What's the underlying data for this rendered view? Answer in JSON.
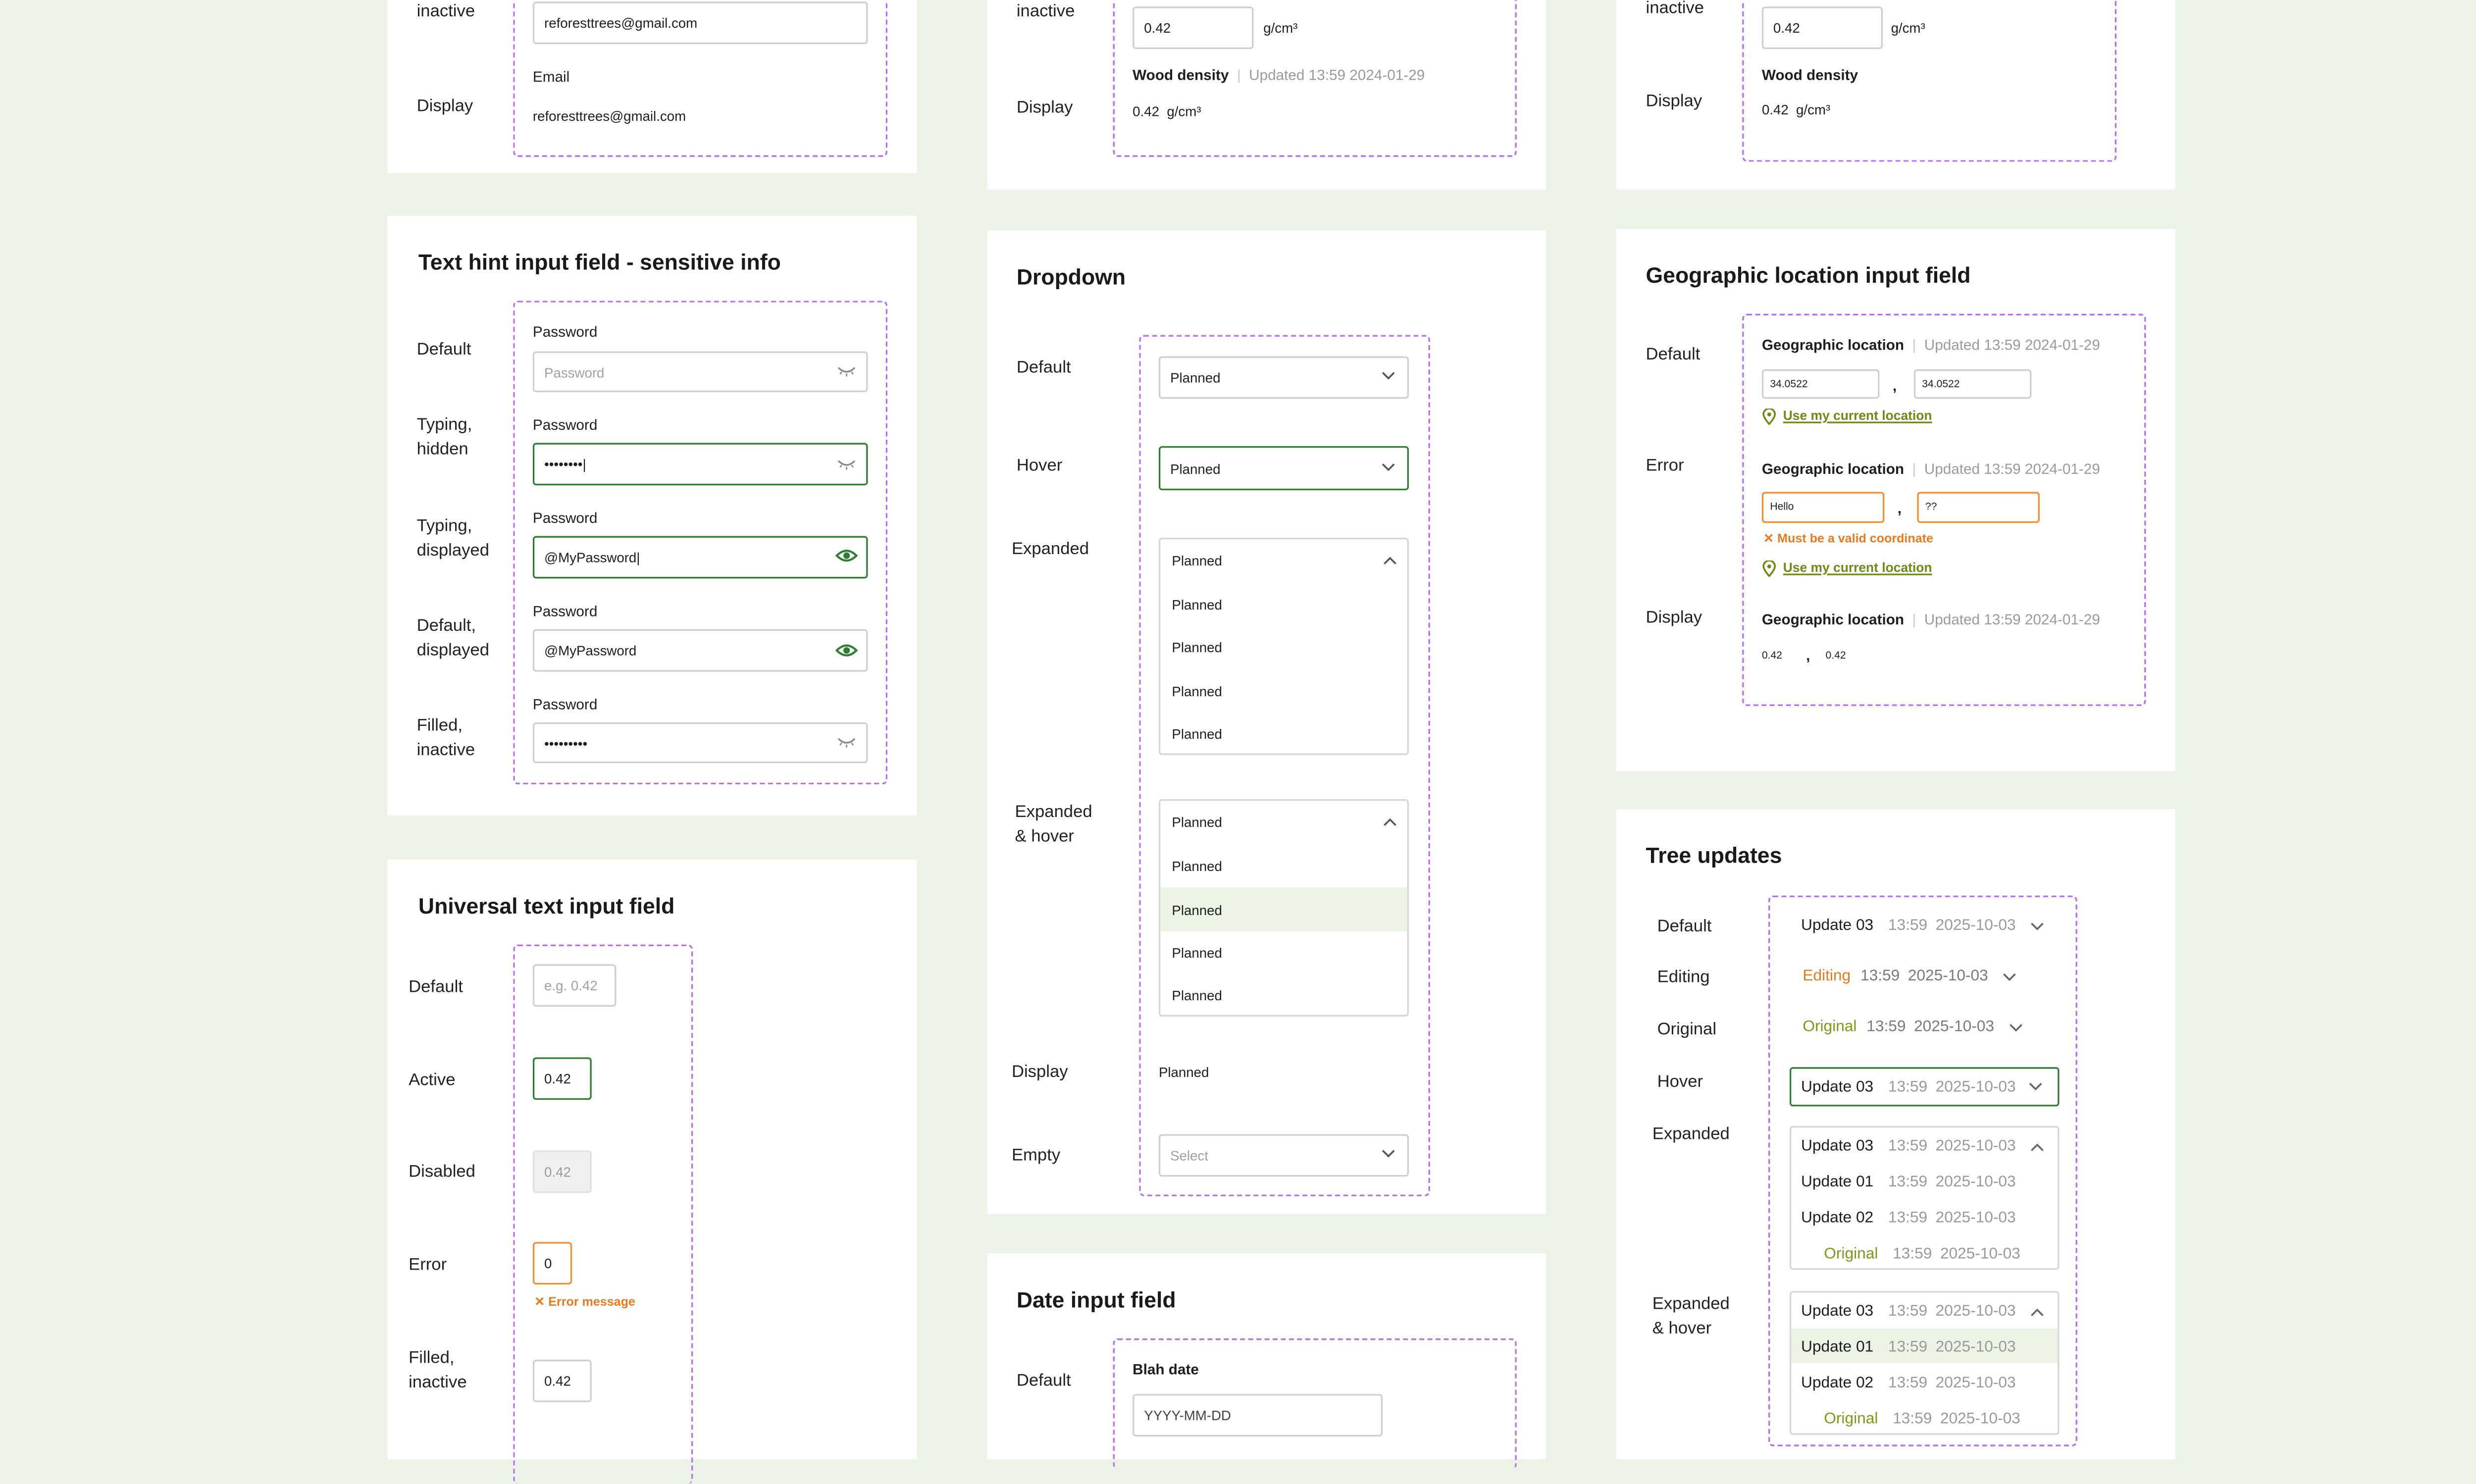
{
  "text_inputs": {
    "row_inactive": "inactive",
    "email_value": "reforesttrees@gmail.com",
    "row_display": "Display",
    "email_label": "Email",
    "email_display": "reforesttrees@gmail.com"
  },
  "density_a": {
    "row_inactive": "inactive",
    "value": "0.42",
    "unit": "g/cm³",
    "label": "Wood density",
    "updated": "Updated 13:59 2024-01-29",
    "row_display": "Display",
    "display_value": "0.42",
    "display_unit": "g/cm³"
  },
  "density_b": {
    "row_inactive": "inactive",
    "value": "0.42",
    "unit": "g/cm³",
    "label": "Wood density",
    "row_display": "Display",
    "display_value": "0.42",
    "display_unit": "g/cm³"
  },
  "password": {
    "title": "Text hint input field - sensitive info",
    "field_label": "Password",
    "placeholder": "Password",
    "states": [
      "Default",
      "Typing, hidden",
      "Typing, displayed",
      "Default, displayed",
      "Filled, inactive"
    ],
    "hidden_typing": "••••••••|",
    "typing_displayed": "@MyPassword|",
    "displayed": "@MyPassword",
    "hidden_filled": "•••••••••",
    "icons": [
      "eye-closed-icon",
      "eye-open-icon"
    ],
    "accent": "#2e7d32"
  },
  "universal": {
    "title": "Universal text input field",
    "states": [
      "Default",
      "Active",
      "Disabled",
      "Error",
      "Filled, inactive"
    ],
    "placeholder": "e.g. 0.42",
    "active_value": "0.42",
    "disabled_value": "0.42",
    "error_value": "0",
    "error_message": "Error message",
    "filled_value": "0.42",
    "error_color": "#f0902e"
  },
  "dropdown": {
    "title": "Dropdown",
    "states": [
      "Default",
      "Hover",
      "Expanded",
      "Expanded & hover",
      "Display",
      "Empty"
    ],
    "selected": "Planned",
    "options": [
      "Planned",
      "Planned",
      "Planned",
      "Planned"
    ],
    "hover_options": [
      "Planned",
      "Planned",
      "Planned",
      "Planned"
    ],
    "display_value": "Planned",
    "empty_placeholder": "Select"
  },
  "date": {
    "title": "Date input field",
    "state_default": "Default",
    "label": "Blah date",
    "placeholder": "YYYY-MM-DD"
  },
  "geo": {
    "title": "Geographic location input field",
    "states": [
      "Default",
      "Error",
      "Display"
    ],
    "label": "Geographic location",
    "updated": "Updated 13:59 2024-01-29",
    "default_lat": "34.0522",
    "default_lng": "34.0522",
    "error_lat": "Hello",
    "error_lng": "??",
    "error_message": "Must be a valid coordinate",
    "use_location": "Use my current location",
    "display_lat": "0.42",
    "display_lng": "0.42",
    "comma": ","
  },
  "tree_updates": {
    "title": "Tree updates",
    "states": [
      "Default",
      "Editing",
      "Original",
      "Hover",
      "Expanded",
      "Expanded & hover"
    ],
    "time": "13:59",
    "date": "2025-10-03",
    "update_03": "Update 03",
    "update_01": "Update 01",
    "update_02": "Update 02",
    "editing": "Editing",
    "original": "Original",
    "colors": {
      "editing": "#e97b1e",
      "original": "#7a9a1c",
      "hover_row": "#eaf3e4"
    }
  }
}
